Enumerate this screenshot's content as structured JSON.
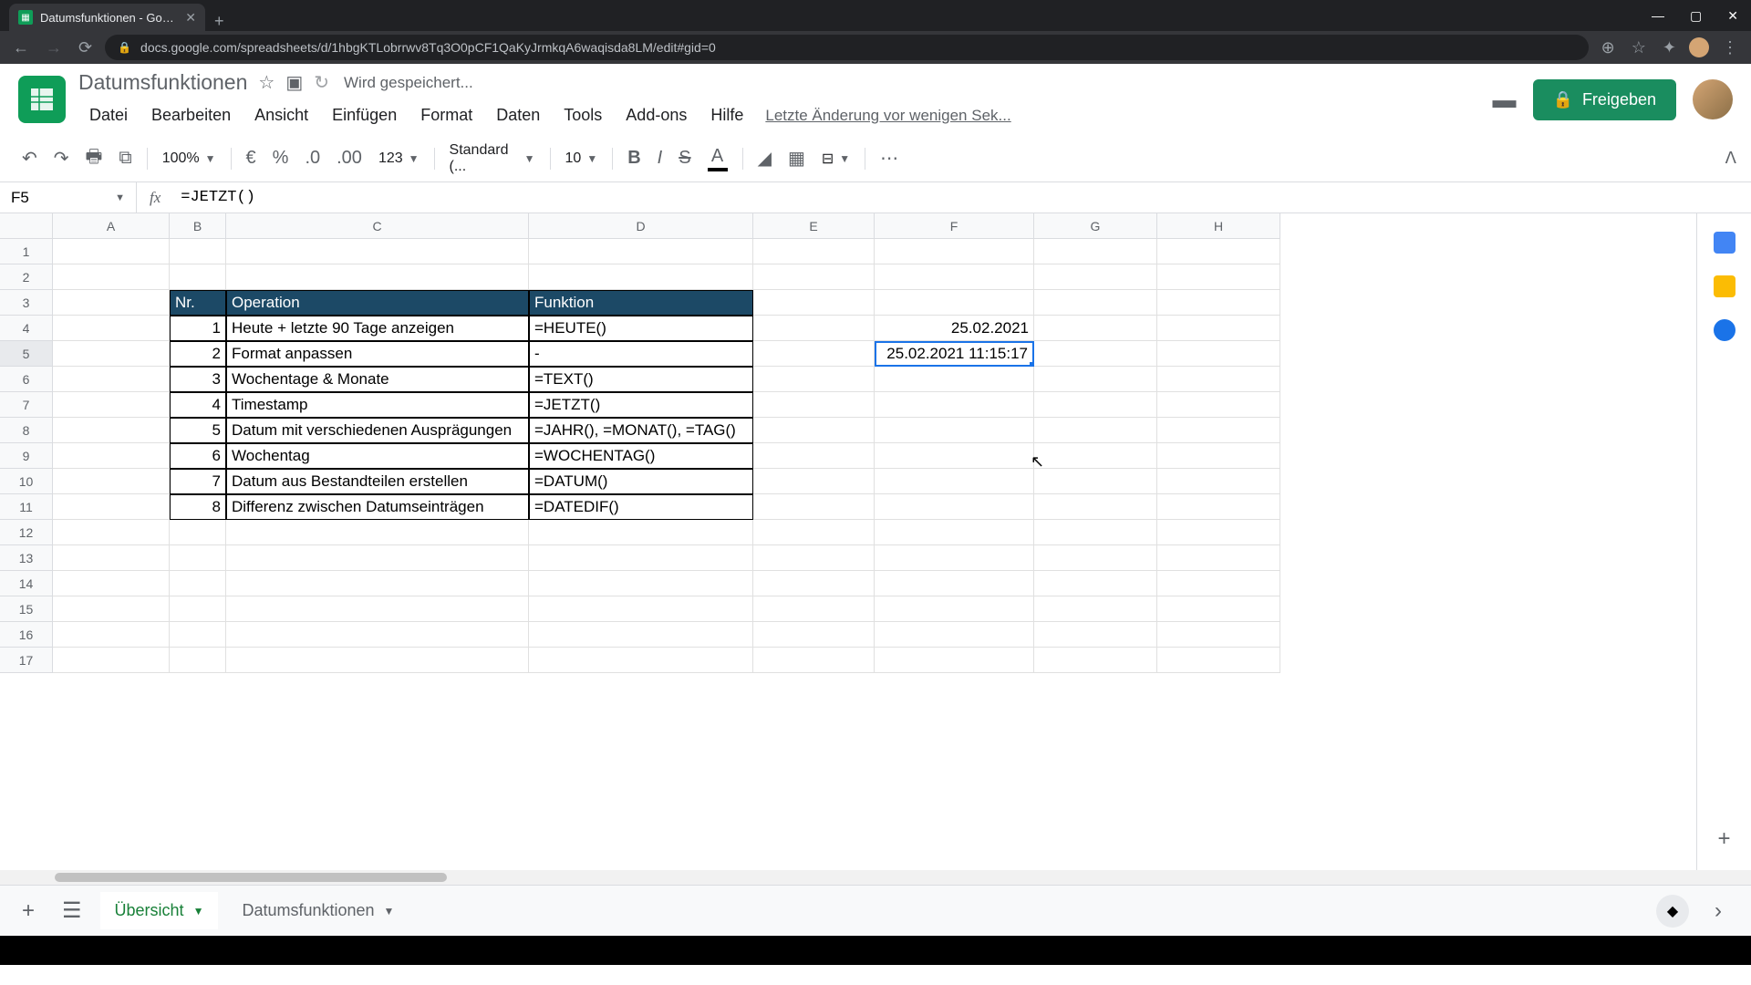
{
  "browser": {
    "tab_title": "Datumsfunktionen - Google Tab...",
    "url": "docs.google.com/spreadsheets/d/1hbgKTLobrrwv8Tq3O0pCF1QaKyJrmkqA6waqisda8LM/edit#gid=0"
  },
  "doc": {
    "title": "Datumsfunktionen",
    "saving": "Wird gespeichert...",
    "share": "Freigeben",
    "last_edit": "Letzte Änderung vor wenigen Sek..."
  },
  "menu": {
    "file": "Datei",
    "edit": "Bearbeiten",
    "view": "Ansicht",
    "insert": "Einfügen",
    "format": "Format",
    "data": "Daten",
    "tools": "Tools",
    "addons": "Add-ons",
    "help": "Hilfe"
  },
  "toolbar": {
    "zoom": "100%",
    "font": "Standard (...",
    "fontsize": "10",
    "numfmt": "123"
  },
  "formula": {
    "cell_ref": "F5",
    "value": "=JETZT()"
  },
  "columns": [
    "A",
    "B",
    "C",
    "D",
    "E",
    "F",
    "G",
    "H"
  ],
  "table": {
    "headers": {
      "nr": "Nr.",
      "operation": "Operation",
      "funktion": "Funktion"
    },
    "rows": [
      {
        "nr": "1",
        "op": "Heute + letzte 90 Tage anzeigen",
        "fn": "=HEUTE()"
      },
      {
        "nr": "2",
        "op": "Format anpassen",
        "fn": "-"
      },
      {
        "nr": "3",
        "op": "Wochentage & Monate",
        "fn": "=TEXT()"
      },
      {
        "nr": "4",
        "op": "Timestamp",
        "fn": "=JETZT()"
      },
      {
        "nr": "5",
        "op": "Datum mit verschiedenen Ausprägungen",
        "fn": "=JAHR(), =MONAT(), =TAG()"
      },
      {
        "nr": "6",
        "op": "Wochentag",
        "fn": "=WOCHENTAG()"
      },
      {
        "nr": "7",
        "op": "Datum aus Bestandteilen erstellen",
        "fn": "=DATUM()"
      },
      {
        "nr": "8",
        "op": "Differenz zwischen Datumseinträgen",
        "fn": "=DATEDIF()"
      }
    ]
  },
  "cells": {
    "F4": "25.02.2021",
    "F5": "25.02.2021 11:15:17"
  },
  "tabs": {
    "tab1": "Übersicht",
    "tab2": "Datumsfunktionen"
  }
}
